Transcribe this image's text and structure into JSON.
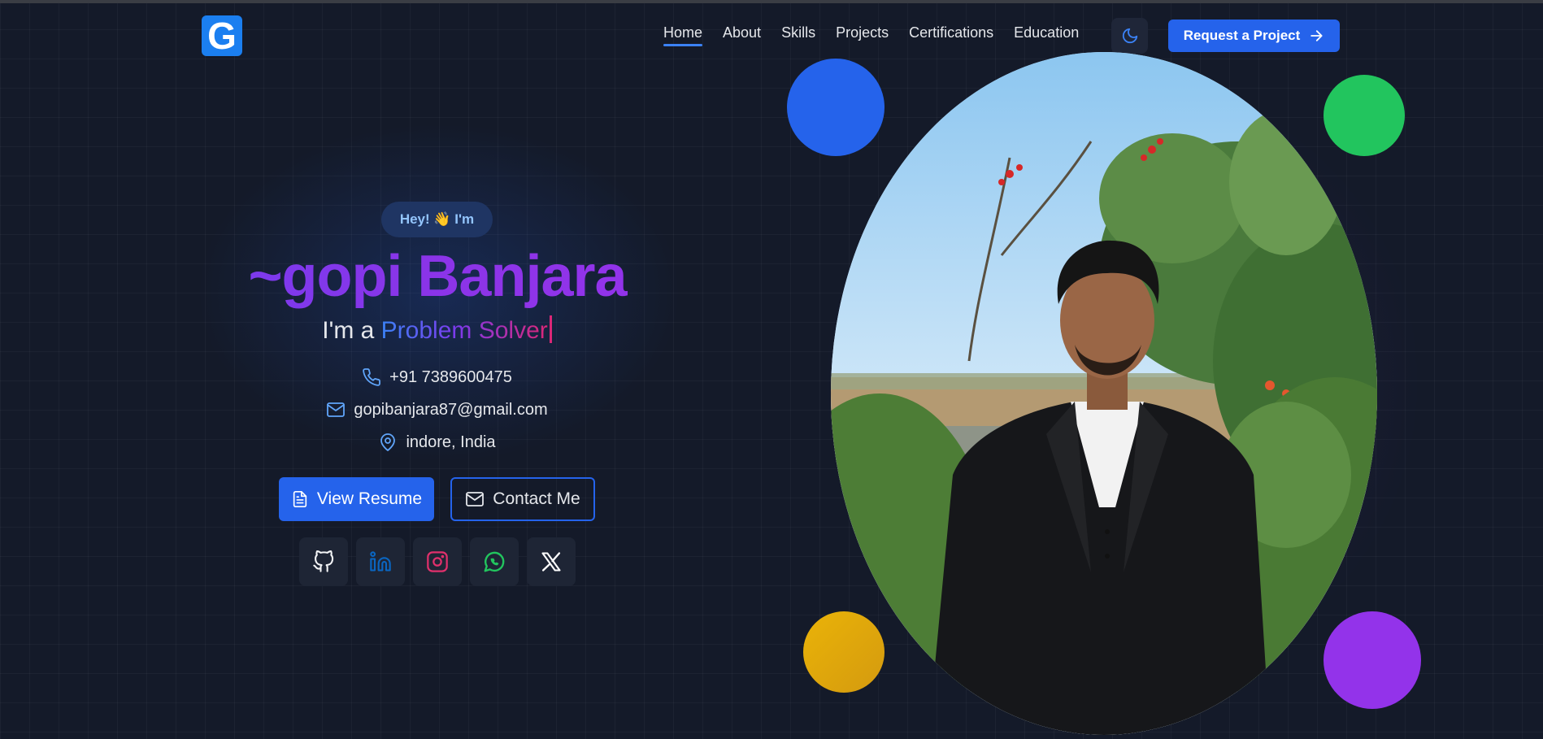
{
  "logo": {
    "letter": "G"
  },
  "nav": {
    "items": [
      {
        "label": "Home",
        "active": true
      },
      {
        "label": "About"
      },
      {
        "label": "Skills"
      },
      {
        "label": "Projects"
      },
      {
        "label": "Certifications"
      },
      {
        "label": "Education"
      }
    ],
    "theme_icon": "moon-icon",
    "cta_label": "Request a Project",
    "cta_icon": "arrow-right-icon"
  },
  "hero": {
    "greeting": "Hey! 👋 I'm",
    "name": "~gopi Banjara",
    "role_prefix": "I'm a",
    "role_typed": "Problem Solver",
    "phone": "+91 7389600475",
    "email": "gopibanjara87@gmail.com",
    "location": "indore, India",
    "resume_label": "View Resume",
    "contact_label": "Contact Me",
    "socials": [
      "github-icon",
      "linkedin-icon",
      "instagram-icon",
      "whatsapp-icon",
      "x-icon"
    ]
  },
  "colors": {
    "background": "#141a29",
    "accent": "#2563eb",
    "name_gradient": "#7c3aed",
    "dot_blue": "#2563eb",
    "dot_green": "#22c55e",
    "dot_yellow": "#eab308",
    "dot_purple": "#9333ea"
  }
}
